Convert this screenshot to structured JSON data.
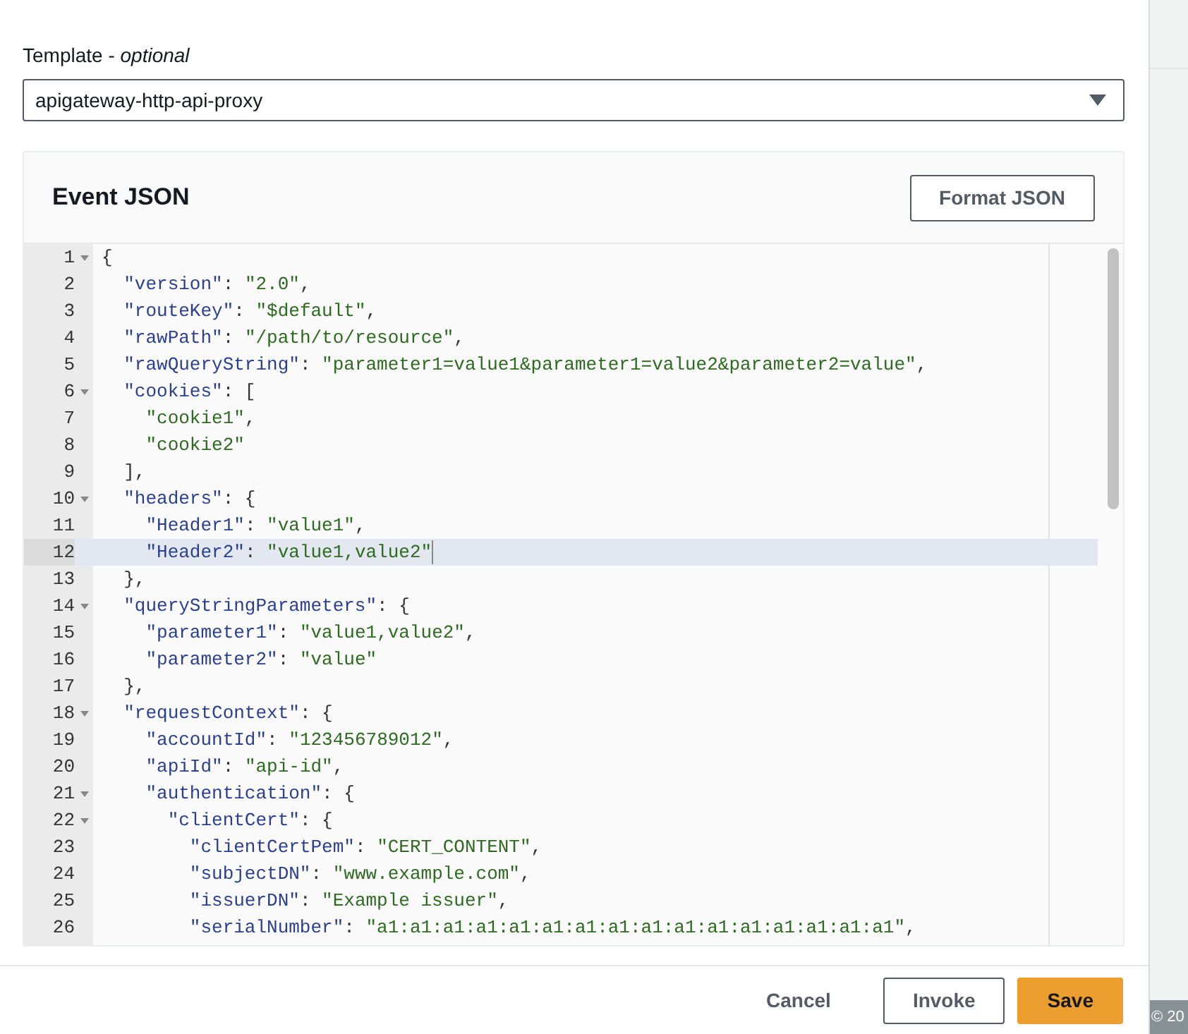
{
  "template": {
    "label": "Template - *optional*",
    "value": "apigateway-http-api-proxy"
  },
  "editor": {
    "title": "Event JSON",
    "format_button": "Format JSON",
    "lines": [
      {
        "num": "1",
        "fold": true,
        "selected": false,
        "text": "{"
      },
      {
        "num": "2",
        "fold": false,
        "selected": false,
        "text": "  \"version\": \"2.0\","
      },
      {
        "num": "3",
        "fold": false,
        "selected": false,
        "text": "  \"routeKey\": \"$default\","
      },
      {
        "num": "4",
        "fold": false,
        "selected": false,
        "text": "  \"rawPath\": \"/path/to/resource\","
      },
      {
        "num": "5",
        "fold": false,
        "selected": false,
        "text": "  \"rawQueryString\": \"parameter1=value1&parameter1=value2&parameter2=value\","
      },
      {
        "num": "6",
        "fold": true,
        "selected": false,
        "text": "  \"cookies\": ["
      },
      {
        "num": "7",
        "fold": false,
        "selected": false,
        "text": "    \"cookie1\","
      },
      {
        "num": "8",
        "fold": false,
        "selected": false,
        "text": "    \"cookie2\""
      },
      {
        "num": "9",
        "fold": false,
        "selected": false,
        "text": "  ],"
      },
      {
        "num": "10",
        "fold": true,
        "selected": false,
        "text": "  \"headers\": {"
      },
      {
        "num": "11",
        "fold": false,
        "selected": false,
        "text": "    \"Header1\": \"value1\","
      },
      {
        "num": "12",
        "fold": false,
        "selected": true,
        "text": "    \"Header2\": \"value1,value2\""
      },
      {
        "num": "13",
        "fold": false,
        "selected": false,
        "text": "  },"
      },
      {
        "num": "14",
        "fold": true,
        "selected": false,
        "text": "  \"queryStringParameters\": {"
      },
      {
        "num": "15",
        "fold": false,
        "selected": false,
        "text": "    \"parameter1\": \"value1,value2\","
      },
      {
        "num": "16",
        "fold": false,
        "selected": false,
        "text": "    \"parameter2\": \"value\""
      },
      {
        "num": "17",
        "fold": false,
        "selected": false,
        "text": "  },"
      },
      {
        "num": "18",
        "fold": true,
        "selected": false,
        "text": "  \"requestContext\": {"
      },
      {
        "num": "19",
        "fold": false,
        "selected": false,
        "text": "    \"accountId\": \"123456789012\","
      },
      {
        "num": "20",
        "fold": false,
        "selected": false,
        "text": "    \"apiId\": \"api-id\","
      },
      {
        "num": "21",
        "fold": true,
        "selected": false,
        "text": "    \"authentication\": {"
      },
      {
        "num": "22",
        "fold": true,
        "selected": false,
        "text": "      \"clientCert\": {"
      },
      {
        "num": "23",
        "fold": false,
        "selected": false,
        "text": "        \"clientCertPem\": \"CERT_CONTENT\","
      },
      {
        "num": "24",
        "fold": false,
        "selected": false,
        "text": "        \"subjectDN\": \"www.example.com\","
      },
      {
        "num": "25",
        "fold": false,
        "selected": false,
        "text": "        \"issuerDN\": \"Example issuer\","
      },
      {
        "num": "26",
        "fold": false,
        "selected": false,
        "text": "        \"serialNumber\": \"a1:a1:a1:a1:a1:a1:a1:a1:a1:a1:a1:a1:a1:a1:a1:a1\","
      }
    ]
  },
  "buttons": [
    {
      "label": "Cancel",
      "kind": "link"
    },
    {
      "label": "Invoke",
      "kind": "normal"
    },
    {
      "label": "Save",
      "kind": "primary"
    }
  ],
  "footer": {
    "text": "© 20"
  }
}
